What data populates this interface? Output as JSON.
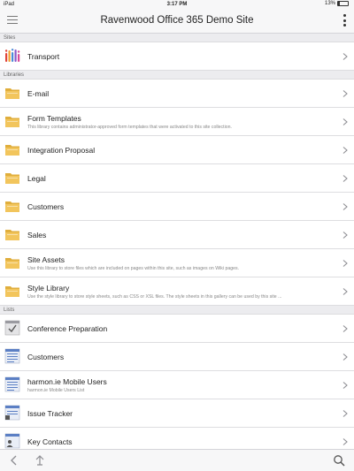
{
  "statusbar": {
    "carrier": "iPad",
    "time": "3:17 PM",
    "battery": "13%"
  },
  "navbar": {
    "title": "Ravenwood Office 365 Demo Site"
  },
  "sections": {
    "sites": {
      "header": "Sites",
      "items": [
        {
          "label": "Transport",
          "desc": "",
          "icon": "app-icon"
        }
      ]
    },
    "libraries": {
      "header": "Libraries",
      "items": [
        {
          "label": "E-mail",
          "desc": "",
          "icon": "folder-icon"
        },
        {
          "label": "Form Templates",
          "desc": "This library contains administrator-approved form templates that were activated to this site collection.",
          "icon": "folder-icon"
        },
        {
          "label": "Integration Proposal",
          "desc": "",
          "icon": "folder-icon"
        },
        {
          "label": "Legal",
          "desc": "",
          "icon": "folder-icon"
        },
        {
          "label": "Customers",
          "desc": "",
          "icon": "folder-icon"
        },
        {
          "label": "Sales",
          "desc": "",
          "icon": "folder-icon"
        },
        {
          "label": "Site Assets",
          "desc": "Use this library to store files which are included on pages within this site, such as images on Wiki pages.",
          "icon": "folder-icon"
        },
        {
          "label": "Style Library",
          "desc": "Use the style library to store style sheets, such as CSS or XSL files. The style sheets in this gallery can be used by this site ...",
          "icon": "folder-icon"
        }
      ]
    },
    "lists": {
      "header": "Lists",
      "items": [
        {
          "label": "Conference Preparation",
          "desc": "",
          "icon": "task-list-icon"
        },
        {
          "label": "Customers",
          "desc": "",
          "icon": "list-icon"
        },
        {
          "label": "harmon.ie Mobile Users",
          "desc": "harmon.ie Mobile Users List",
          "icon": "list-icon"
        },
        {
          "label": "Issue Tracker",
          "desc": "",
          "icon": "issue-list-icon"
        },
        {
          "label": "Key Contacts",
          "desc": "",
          "icon": "contacts-list-icon"
        }
      ]
    }
  },
  "colors": {
    "folder": "#f2c55c",
    "folder_dark": "#e0ae3c",
    "list_blue": "#5b7fc4",
    "chevron": "#8e8e93"
  }
}
